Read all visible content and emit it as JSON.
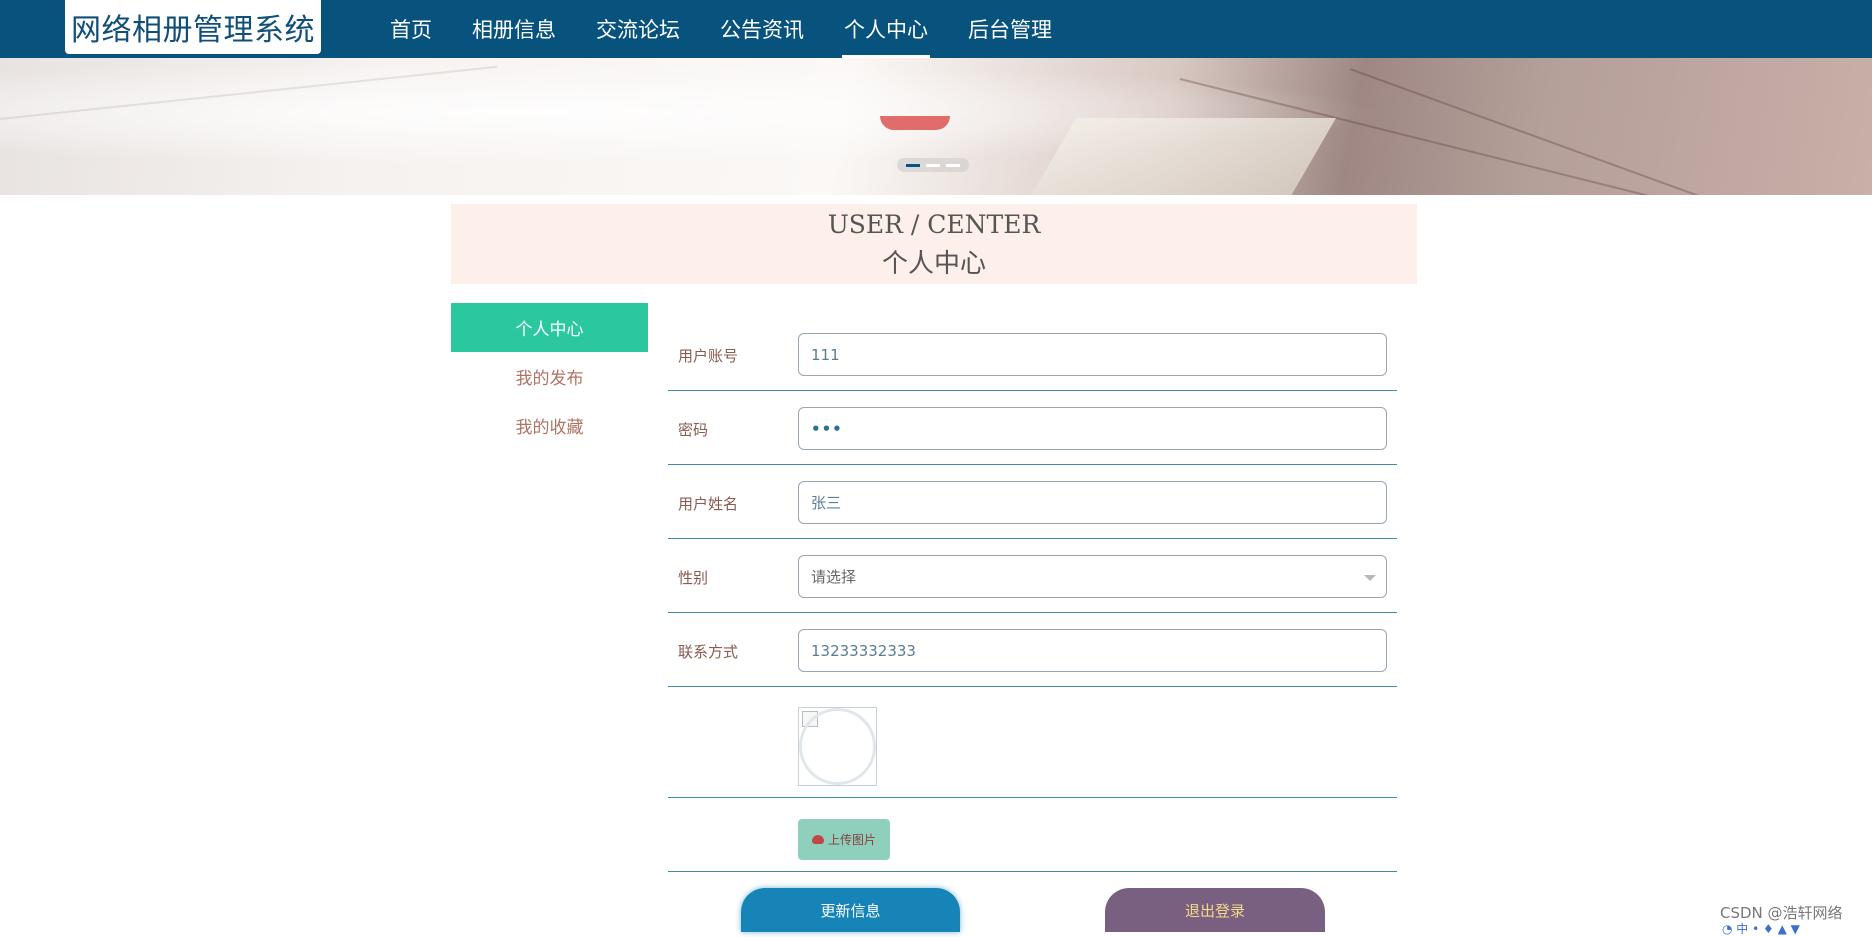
{
  "brand": {
    "title": "网络相册管理系统"
  },
  "nav": {
    "items": [
      "首页",
      "相册信息",
      "交流论坛",
      "公告资讯",
      "个人中心",
      "后台管理"
    ],
    "active": "个人中心"
  },
  "banner": {
    "slides": 3,
    "active_slide": 1
  },
  "section": {
    "title_en": "USER / CENTER",
    "title_zh": "个人中心"
  },
  "sidebar": {
    "items": [
      {
        "label": "个人中心",
        "active": true
      },
      {
        "label": "我的发布",
        "active": false
      },
      {
        "label": "我的收藏",
        "active": false
      }
    ]
  },
  "form": {
    "username": {
      "label": "用户账号",
      "value": "111"
    },
    "password": {
      "label": "密码",
      "value": "•••"
    },
    "fullname": {
      "label": "用户姓名",
      "value": "张三"
    },
    "gender": {
      "label": "性别",
      "placeholder": "请选择"
    },
    "phone": {
      "label": "联系方式",
      "value": "13233332333"
    },
    "upload_label": "上传图片"
  },
  "actions": {
    "update": "更新信息",
    "logout": "退出登录"
  },
  "watermark": "CSDN @浩轩网络",
  "colors": {
    "nav_bg": "#08527e",
    "sidebar_active": "#2bc8a0",
    "update_btn": "#1684b6",
    "logout_btn": "#7a6080"
  }
}
